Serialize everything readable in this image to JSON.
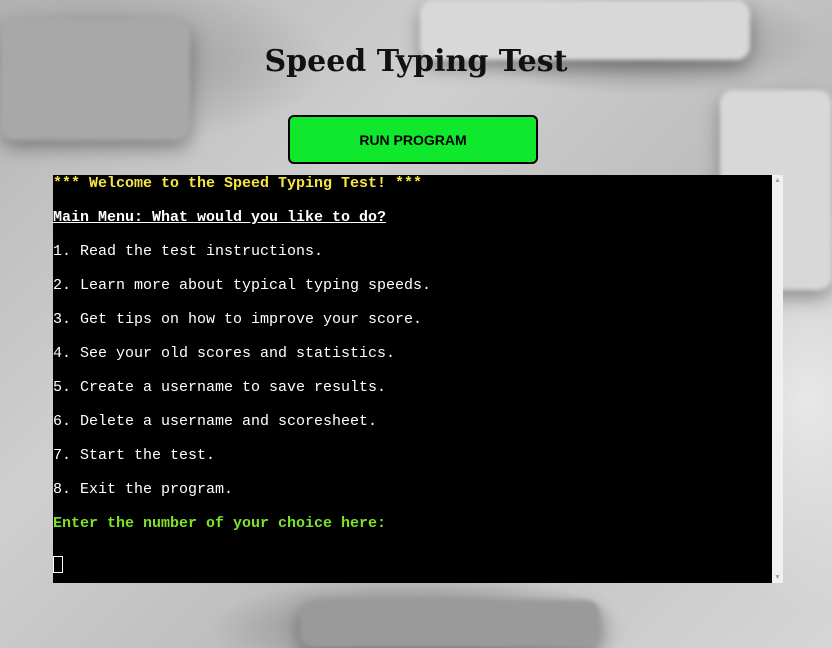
{
  "page": {
    "title": "Speed Typing Test"
  },
  "toolbar": {
    "run_label": "RUN PROGRAM"
  },
  "terminal": {
    "welcome": "*** Welcome to the Speed Typing Test! ***",
    "menu_title": "Main Menu: What would you like to do?",
    "options": [
      "1. Read the test instructions.",
      "2. Learn more about typical typing speeds.",
      "3. Get tips on how to improve your score.",
      "4. See your old scores and statistics.",
      "5. Create a username to save results.",
      "6. Delete a username and scoresheet.",
      "7. Start the test.",
      "8. Exit the program."
    ],
    "prompt": "Enter the number of your choice here:",
    "input_value": ""
  },
  "colors": {
    "button": "#0fe82c",
    "welcome": "#f5e642",
    "prompt": "#7ee22a",
    "terminal_bg": "#000000"
  },
  "icons": {
    "scroll_up": "triangle-up-icon",
    "scroll_down": "triangle-down-icon"
  }
}
